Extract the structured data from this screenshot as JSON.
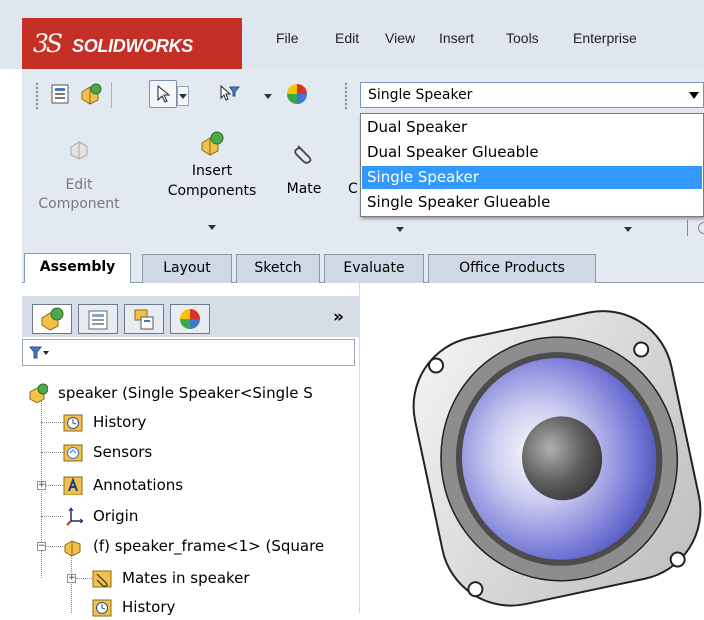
{
  "app": {
    "logo_ds": "3S",
    "logo_text": "SOLIDWORKS"
  },
  "menu": [
    "File",
    "Edit",
    "View",
    "Insert",
    "Tools",
    "Enterprise"
  ],
  "config": {
    "current": "Single Speaker",
    "options": [
      "Dual Speaker",
      "Dual Speaker Glueable",
      "Single Speaker",
      "Single Speaker Glueable"
    ],
    "selected_index": 2
  },
  "ribbon": {
    "edit_component": [
      "Edit",
      "Component"
    ],
    "insert_components": [
      "Insert",
      "Components"
    ],
    "mate": "Mate",
    "partial_c": "C"
  },
  "tabs": [
    "Assembly",
    "Layout",
    "Sketch",
    "Evaluate",
    "Office Products"
  ],
  "panel": {
    "collapse_glyph": "»"
  },
  "tree": {
    "root": "speaker  (Single Speaker<Single S",
    "items": [
      "History",
      "Sensors",
      "Annotations",
      "Origin",
      "(f) speaker_frame<1> (Square",
      "Mates in speaker",
      "History"
    ]
  },
  "colors": {
    "accent": "#3399ff",
    "logo_red": "#c62f26",
    "ribbon_bg": "#e3e9f1"
  }
}
